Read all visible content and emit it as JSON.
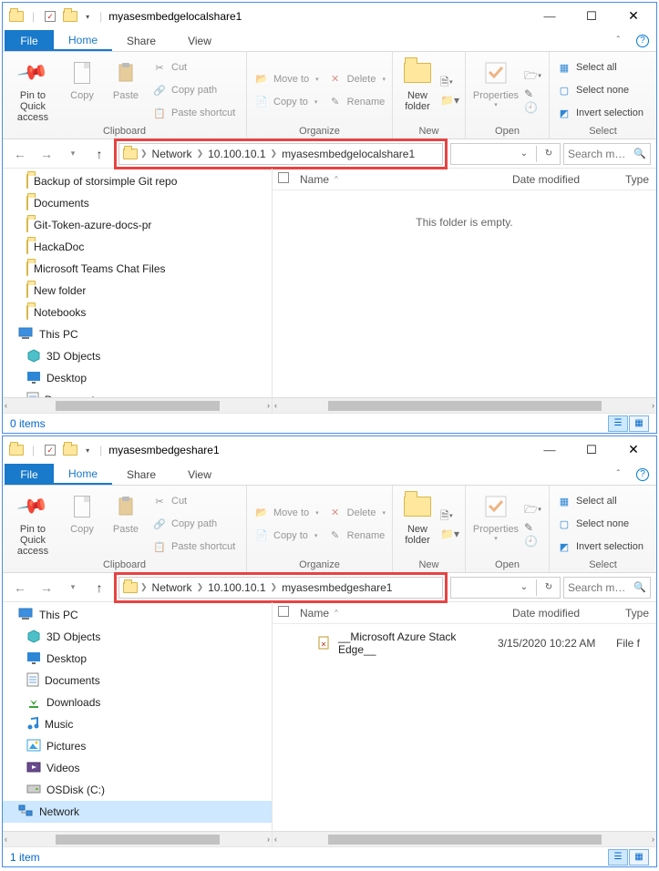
{
  "win1": {
    "title": "myasesmbedgelocalshare1",
    "menu": {
      "file": "File",
      "tabs": [
        "Home",
        "Share",
        "View"
      ],
      "active_idx": 0
    },
    "ribbon": {
      "groups": [
        "Clipboard",
        "Organize",
        "New",
        "Open",
        "Select"
      ],
      "clipboard": {
        "pin": "Pin to Quick access",
        "copy": "Copy",
        "paste": "Paste",
        "cut": "Cut",
        "copypath": "Copy path",
        "shortcut": "Paste shortcut"
      },
      "organize": {
        "moveto": "Move to",
        "copyto": "Copy to",
        "delete": "Delete",
        "rename": "Rename"
      },
      "new": {
        "newfolder": "New folder"
      },
      "open": {
        "properties": "Properties"
      },
      "select": {
        "all": "Select all",
        "none": "Select none",
        "invert": "Invert selection"
      }
    },
    "breadcrumb": [
      "Network",
      "10.100.10.1",
      "myasesmbedgelocalshare1"
    ],
    "search_placeholder": "Search m…",
    "columns": {
      "name": "Name",
      "date": "Date modified",
      "type": "Type"
    },
    "nav": [
      {
        "label": "Backup of storsimple Git repo",
        "icon": "folder"
      },
      {
        "label": "Documents",
        "icon": "folder"
      },
      {
        "label": "Git-Token-azure-docs-pr",
        "icon": "folder"
      },
      {
        "label": "HackaDoc",
        "icon": "folder"
      },
      {
        "label": "Microsoft Teams Chat Files",
        "icon": "folder"
      },
      {
        "label": "New folder",
        "icon": "folder"
      },
      {
        "label": "Notebooks",
        "icon": "folder"
      },
      {
        "label": "This PC",
        "icon": "thispc",
        "l": 0
      },
      {
        "label": "3D Objects",
        "icon": "3d"
      },
      {
        "label": "Desktop",
        "icon": "desktop"
      },
      {
        "label": "Documents",
        "icon": "docs"
      }
    ],
    "empty_message": "This folder is empty.",
    "status": "0 items"
  },
  "win2": {
    "title": "myasesmbedgeshare1",
    "menu": {
      "file": "File",
      "tabs": [
        "Home",
        "Share",
        "View"
      ],
      "active_idx": 0
    },
    "ribbon": {
      "groups": [
        "Clipboard",
        "Organize",
        "New",
        "Open",
        "Select"
      ],
      "clipboard": {
        "pin": "Pin to Quick access",
        "copy": "Copy",
        "paste": "Paste",
        "cut": "Cut",
        "copypath": "Copy path",
        "shortcut": "Paste shortcut"
      },
      "organize": {
        "moveto": "Move to",
        "copyto": "Copy to",
        "delete": "Delete",
        "rename": "Rename"
      },
      "new": {
        "newfolder": "New folder"
      },
      "open": {
        "properties": "Properties"
      },
      "select": {
        "all": "Select all",
        "none": "Select none",
        "invert": "Invert selection"
      }
    },
    "breadcrumb": [
      "Network",
      "10.100.10.1",
      "myasesmbedgeshare1"
    ],
    "search_placeholder": "Search m…",
    "columns": {
      "name": "Name",
      "date": "Date modified",
      "type": "Type"
    },
    "nav": [
      {
        "label": "This PC",
        "icon": "thispc",
        "l": 0
      },
      {
        "label": "3D Objects",
        "icon": "3d"
      },
      {
        "label": "Desktop",
        "icon": "desktop"
      },
      {
        "label": "Documents",
        "icon": "docs"
      },
      {
        "label": "Downloads",
        "icon": "downloads"
      },
      {
        "label": "Music",
        "icon": "music"
      },
      {
        "label": "Pictures",
        "icon": "pictures"
      },
      {
        "label": "Videos",
        "icon": "videos"
      },
      {
        "label": "OSDisk (C:)",
        "icon": "disk"
      },
      {
        "label": "Network",
        "icon": "network",
        "l": 0,
        "sel": true
      }
    ],
    "files": [
      {
        "name": "__Microsoft Azure Stack Edge__",
        "date": "3/15/2020 10:22 AM",
        "type": "File f"
      }
    ],
    "status": "1 item"
  }
}
